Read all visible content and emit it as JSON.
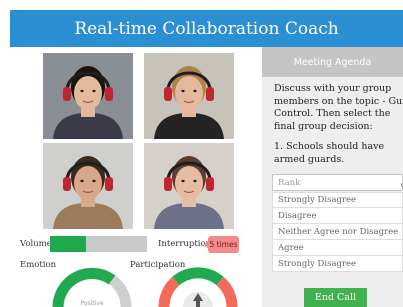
{
  "app": {
    "title": "Real-time Collaboration Coach"
  },
  "participants": [
    {
      "name": "participant-1",
      "hair": "#1b1410",
      "skin": "#e3b99d",
      "shirt": "#3a3a48",
      "bg": "#8a8f96"
    },
    {
      "name": "participant-2",
      "hair": "#b0834a",
      "skin": "#e5b79c",
      "shirt": "#232323",
      "bg": "#c8c3ba"
    },
    {
      "name": "participant-3",
      "hair": "#3a2a20",
      "skin": "#d9a88a",
      "shirt": "#9b7b5e",
      "bg": "#cfcfcd"
    },
    {
      "name": "participant-4",
      "hair": "#5b3f2c",
      "skin": "#e6bda4",
      "shirt": "#6e6f88",
      "bg": "#d5d0c9"
    }
  ],
  "metrics": {
    "volume_label": "Volume",
    "volume_level": 0.37,
    "interruption_label": "Interruption",
    "interruption_value": "5 times",
    "emotion_label": "Emotion",
    "emotion_value": "Positive",
    "participation_label": "Participation",
    "colors": {
      "green": "#1faa50",
      "red": "#f26b5b",
      "grey": "#cfcfcf",
      "accent": "#2b8fd3"
    }
  },
  "agenda": {
    "header": "Meeting Agenda",
    "instructions": "Discuss with your group\nmembers on the topic - Gun\nControl. Then select the\nfinal group decision:",
    "item": "1. Schools should have\narmed guards.",
    "select_placeholder": "Rank",
    "options": [
      "Strongly Disagree",
      "Disagree",
      "Neither Agree nor Disagree",
      "Agree",
      "Strongly Disagree"
    ],
    "end_call_label": "End Call"
  }
}
